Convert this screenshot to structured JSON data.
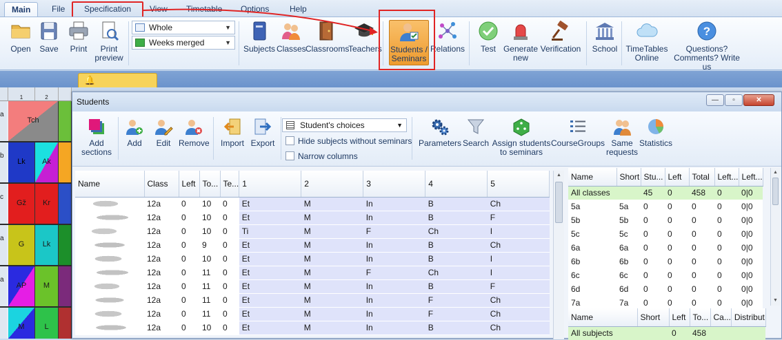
{
  "ribbon": {
    "tabs": [
      "Main",
      "File",
      "Specification",
      "View",
      "Timetable",
      "Options",
      "Help"
    ],
    "buttons": {
      "open": "Open",
      "save": "Save",
      "print": "Print",
      "print_preview": "Print\npreview",
      "subjects": "Subjects",
      "classes": "Classes",
      "classrooms": "Classrooms",
      "teachers": "Teachers",
      "students_seminars": "Students /\nSeminars",
      "relations": "Relations",
      "test": "Test",
      "generate_new": "Generate\nnew",
      "verification": "Verification",
      "school": "School",
      "timetables_online": "TimeTables\nOnline",
      "questions": "Questions?\nComments? Write us"
    },
    "view_combo": "Whole",
    "weeks_combo": "Weeks merged"
  },
  "timetable": {
    "col_numbers": [
      "1",
      "2"
    ],
    "row_labels": [
      "a",
      "b",
      "c",
      "a",
      "a",
      ""
    ],
    "cells": [
      [
        "Tch",
        ""
      ],
      [
        "Lk",
        "Ak"
      ],
      [
        "Gž",
        "Kr"
      ],
      [
        "G",
        "Lk"
      ],
      [
        "AP",
        "M"
      ],
      [
        "M",
        "L"
      ]
    ]
  },
  "window": {
    "title": "Students",
    "toolbar": {
      "add_sections": "Add\nsections",
      "add": "Add",
      "edit": "Edit",
      "remove": "Remove",
      "import": "Import",
      "export": "Export",
      "choices_combo": "Student's choices",
      "hide_subjects": "Hide subjects without seminars",
      "narrow_columns": "Narrow columns",
      "parameters": "Parameters",
      "search": "Search",
      "assign_students": "Assign students\nto seminars",
      "coursegroups": "CourseGroups",
      "same_requests": "Same\nrequests",
      "statistics": "Statistics"
    }
  },
  "students_table": {
    "columns": [
      "Name",
      "Class",
      "Left",
      "To...",
      "Te...",
      "1",
      "2",
      "3",
      "4",
      "5"
    ],
    "rows": [
      [
        "",
        "12a",
        "0",
        "10",
        "0",
        "Et",
        "M",
        "In",
        "B",
        "Ch"
      ],
      [
        "",
        "12a",
        "0",
        "10",
        "0",
        "Et",
        "M",
        "In",
        "B",
        "F"
      ],
      [
        "",
        "12a",
        "0",
        "10",
        "0",
        "Ti",
        "M",
        "F",
        "Ch",
        "I"
      ],
      [
        "",
        "12a",
        "0",
        "9",
        "0",
        "Et",
        "M",
        "In",
        "B",
        "Ch"
      ],
      [
        "",
        "12a",
        "0",
        "10",
        "0",
        "Et",
        "M",
        "In",
        "B",
        "I"
      ],
      [
        "",
        "12a",
        "0",
        "11",
        "0",
        "Et",
        "M",
        "F",
        "Ch",
        "I"
      ],
      [
        "",
        "12a",
        "0",
        "11",
        "0",
        "Et",
        "M",
        "In",
        "B",
        "F"
      ],
      [
        "",
        "12a",
        "0",
        "11",
        "0",
        "Et",
        "M",
        "In",
        "F",
        "Ch"
      ],
      [
        "",
        "12a",
        "0",
        "11",
        "0",
        "Et",
        "M",
        "In",
        "F",
        "Ch"
      ],
      [
        "",
        "12a",
        "0",
        "10",
        "0",
        "Et",
        "M",
        "In",
        "B",
        "Ch"
      ]
    ]
  },
  "classes_table": {
    "columns": [
      "Name",
      "Short",
      "Stu...",
      "Left",
      "Total",
      "Left...",
      "Left..."
    ],
    "rows": [
      [
        "All classes",
        "",
        "45",
        "0",
        "458",
        "0",
        "0|0"
      ],
      [
        "5a",
        "5a",
        "0",
        "0",
        "0",
        "0",
        "0|0"
      ],
      [
        "5b",
        "5b",
        "0",
        "0",
        "0",
        "0",
        "0|0"
      ],
      [
        "5c",
        "5c",
        "0",
        "0",
        "0",
        "0",
        "0|0"
      ],
      [
        "6a",
        "6a",
        "0",
        "0",
        "0",
        "0",
        "0|0"
      ],
      [
        "6b",
        "6b",
        "0",
        "0",
        "0",
        "0",
        "0|0"
      ],
      [
        "6c",
        "6c",
        "0",
        "0",
        "0",
        "0",
        "0|0"
      ],
      [
        "6d",
        "6d",
        "0",
        "0",
        "0",
        "0",
        "0|0"
      ],
      [
        "7a",
        "7a",
        "0",
        "0",
        "0",
        "0",
        "0|0"
      ]
    ]
  },
  "subjects_table": {
    "columns": [
      "Name",
      "Short",
      "Left",
      "To...",
      "Ca...",
      "Distribut"
    ],
    "rows": [
      [
        "All subjects",
        "",
        "0",
        "458",
        "",
        ""
      ]
    ]
  },
  "colors": {
    "highlight_red": "#e02424",
    "selected_row_green": "#d8f5c9",
    "subject_cell_lavender": "#dfe3fa",
    "students_button_orange": "#f2a23b"
  }
}
